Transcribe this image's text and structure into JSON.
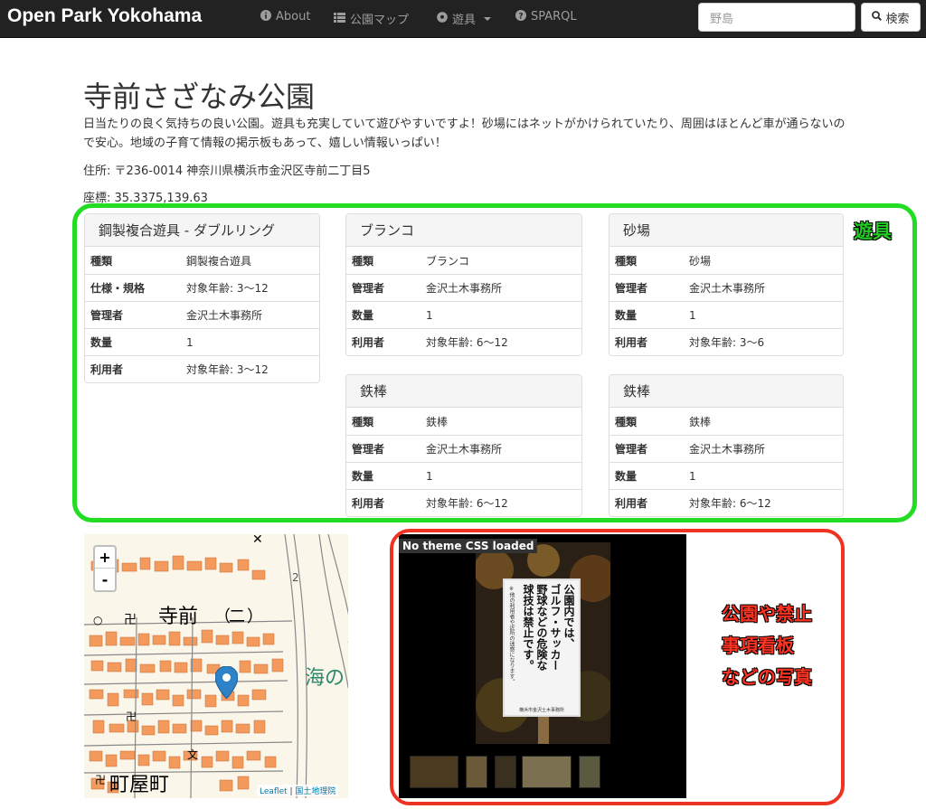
{
  "navbar": {
    "brand": "Open Park Yokohama",
    "about": "About",
    "park_map": "公園マップ",
    "equipment": "遊具",
    "sparql": "SPARQL",
    "search_value": "野島",
    "search_button": "検索"
  },
  "park": {
    "title": "寺前さざなみ公園",
    "description": "日当たりの良く気持ちの良い公園。遊具も充実していて遊びやすいですよ！砂場にはネットがかけられていたり、周囲はほとんど車が通らないので安心。地域の子育て情報の掲示板もあって、嬉しい情報いっぱい！",
    "address": "住所: 〒236-0014 神奈川県横浜市金沢区寺前二丁目5",
    "coords": "座標: 35.3375,139.63"
  },
  "equipment_panels": [
    {
      "title": "鋼製複合遊具 - ダブルリング",
      "rows": [
        {
          "k": "種類",
          "v": "鋼製複合遊具"
        },
        {
          "k": "仕様・規格",
          "v": "対象年齢: 3〜12"
        },
        {
          "k": "管理者",
          "v": "金沢土木事務所"
        },
        {
          "k": "数量",
          "v": "1"
        },
        {
          "k": "利用者",
          "v": "対象年齢: 3〜12"
        }
      ]
    },
    {
      "title": "ブランコ",
      "rows": [
        {
          "k": "種類",
          "v": "ブランコ"
        },
        {
          "k": "管理者",
          "v": "金沢土木事務所"
        },
        {
          "k": "数量",
          "v": "1"
        },
        {
          "k": "利用者",
          "v": "対象年齢: 6〜12"
        }
      ]
    },
    {
      "title": "砂場",
      "rows": [
        {
          "k": "種類",
          "v": "砂場"
        },
        {
          "k": "管理者",
          "v": "金沢土木事務所"
        },
        {
          "k": "数量",
          "v": "1"
        },
        {
          "k": "利用者",
          "v": "対象年齢: 3〜6"
        }
      ]
    },
    {
      "title": "鉄棒",
      "rows": [
        {
          "k": "種類",
          "v": "鉄棒"
        },
        {
          "k": "管理者",
          "v": "金沢土木事務所"
        },
        {
          "k": "数量",
          "v": "1"
        },
        {
          "k": "利用者",
          "v": "対象年齢: 6〜12"
        }
      ]
    },
    {
      "title": "鉄棒",
      "rows": [
        {
          "k": "種類",
          "v": "鉄棒"
        },
        {
          "k": "管理者",
          "v": "金沢土木事務所"
        },
        {
          "k": "数量",
          "v": "1"
        },
        {
          "k": "利用者",
          "v": "対象年齢: 6〜12"
        }
      ]
    }
  ],
  "annotations": {
    "equipment_label": "遊具",
    "photo_label_1": "公園や禁止",
    "photo_label_2": "事項看板",
    "photo_label_3": "などの写真"
  },
  "map": {
    "zoom_in": "+",
    "zoom_out": "-",
    "label_teramae": "寺前",
    "label_ni": "二",
    "label_machiya": "町屋町",
    "label_umi": "海の",
    "label_num": "2",
    "attribution_leaflet": "Leaflet",
    "attribution_sep": " | ",
    "attribution_gsi": "国土地理院"
  },
  "gallery": {
    "no_theme": "No theme CSS loaded",
    "sign_lines": [
      "公園内では、",
      "ゴルフ・サッカー",
      "野球などの危険な",
      "球技は禁止です。"
    ],
    "sign_footer": "横浜市金沢土木事務所",
    "sign_side": "※他の利用者や近所の迷惑になります。"
  },
  "colors": {
    "green_box": "#22dd22",
    "red_box": "#ee3322",
    "navbar_bg": "#222222"
  }
}
